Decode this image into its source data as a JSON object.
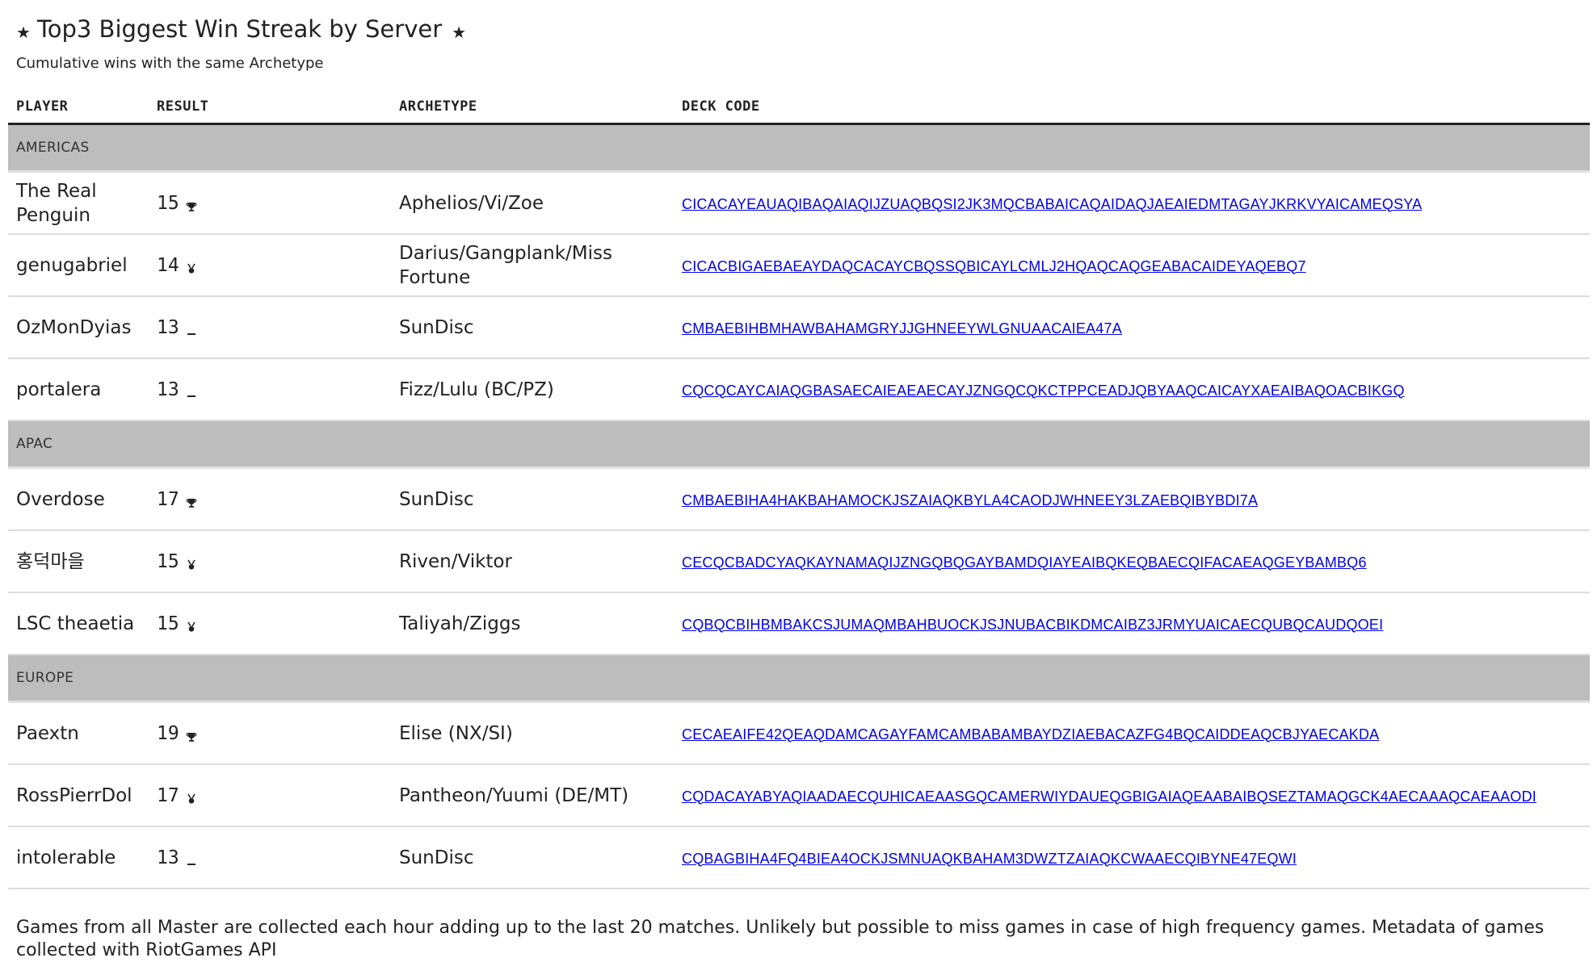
{
  "header": {
    "title": "Top3 Biggest Win Streak by Server",
    "subtitle": "Cumulative wins with the same Archetype",
    "star_icon": "star-icon"
  },
  "columns": [
    "PLAYER",
    "RESULT",
    "ARCHETYPE",
    "DECK CODE"
  ],
  "groups": [
    {
      "name": "AMERICAS",
      "rows": [
        {
          "player": "The Real Penguin",
          "result": "15",
          "icon": "trophy",
          "archetype": "Aphelios/Vi/Zoe",
          "deck": "CICACAYEAUAQIBAQAIAQIJZUAQBQSI2JK3MQCBABAICAQAIDAQJAEAIEDMTAGAYJKRKVYAICAMEQSYA"
        },
        {
          "player": "genugabriel",
          "result": "14",
          "icon": "medal",
          "archetype": "Darius/Gangplank/Miss Fortune",
          "deck": "CICACBIGAEBAEAYDAQCACAYCBQSSQBICAYLCMLJ2HQAQCAQGEABACAIDEYAQEBQ7"
        },
        {
          "player": "OzMonDyias",
          "result": "13",
          "icon": "dash",
          "archetype": "SunDisc",
          "deck": "CMBAEBIHBMHAWBAHAMGRYJJGHNEEYWLGNUAACAIEA47A"
        },
        {
          "player": "portalera",
          "result": "13",
          "icon": "dash",
          "archetype": "Fizz/Lulu (BC/PZ)",
          "deck": "CQCQCAYCAIAQGBASAECAIEAEAECAYJZNGQCQKCTPPCEADJQBYAAQCAICAYXAEAIBAQOACBIKGQ"
        }
      ]
    },
    {
      "name": "APAC",
      "rows": [
        {
          "player": "Overdose",
          "result": "17",
          "icon": "trophy",
          "archetype": "SunDisc",
          "deck": "CMBAEBIHA4HAKBAHAMOCKJSZAIAQKBYLA4CAODJWHNEEY3LZAEBQIBYBDI7A"
        },
        {
          "player": "홍덕마을",
          "result": "15",
          "icon": "medal",
          "archetype": "Riven/Viktor",
          "deck": "CECQCBADCYAQKAYNAMAQIJZNGQBQGAYBAMDQIAYEAIBQKEQBAECQIFACAEAQGEYBAMBQ6"
        },
        {
          "player": "LSC theaetia",
          "result": "15",
          "icon": "medal",
          "archetype": "Taliyah/Ziggs",
          "deck": "CQBQCBIHBMBAKCSJUMAQMBAHBUOCKJSJNUBACBIKDMCAIBZ3JRMYUAICAECQUBQCAUDQOEI"
        }
      ]
    },
    {
      "name": "EUROPE",
      "rows": [
        {
          "player": "Paextn",
          "result": "19",
          "icon": "trophy",
          "archetype": "Elise (NX/SI)",
          "deck": "CECAEAIFE42QEAQDAMCAGAYFAMCAMBABAMBAYDZIAEBACAZFG4BQCAIDDEAQCBJYAECAKDA"
        },
        {
          "player": "RossPierrDol",
          "result": "17",
          "icon": "medal",
          "archetype": "Pantheon/Yuumi (DE/MT)",
          "deck": "CQDACAYABYAQIAADAECQUHICAEAASGQCAMERWIYDAUEQGBIGAIAQEAABAIBQSEZTAMAQGCK4AECAAAQCAEAAODI"
        },
        {
          "player": "intolerable",
          "result": "13",
          "icon": "dash",
          "archetype": "SunDisc",
          "deck": "CQBAGBIHA4FQ4BIEA4OCKJSMNUAQKBAHAM3DWZTZAIAQKCWAAECQIBYNE47EQWI"
        }
      ]
    }
  ],
  "footer": "Games from all Master are collected each hour adding up to the last 20 matches. Unlikely but possible to miss games in case of high frequency games. Metadata of games collected with RiotGames API"
}
